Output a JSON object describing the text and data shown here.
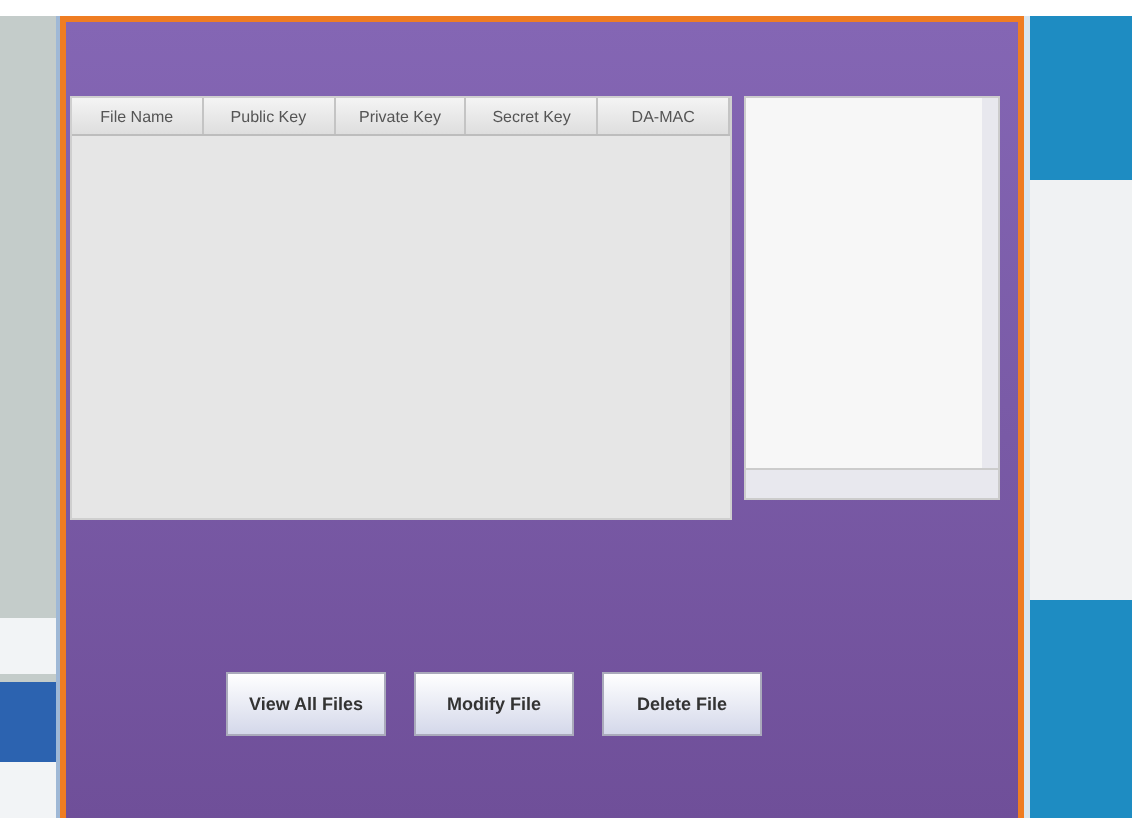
{
  "table": {
    "columns": [
      "File Name",
      "Public Key",
      "Private Key",
      "Secret Key",
      "DA-MAC"
    ]
  },
  "buttons": [
    "View All Files",
    "Modify File",
    "Delete File"
  ]
}
